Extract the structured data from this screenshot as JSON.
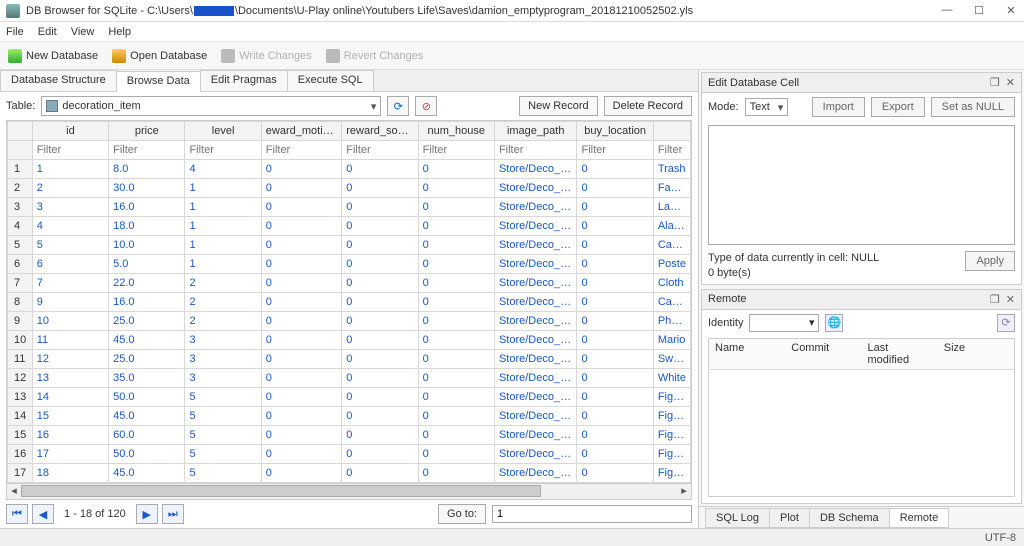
{
  "window": {
    "app": "DB Browser for SQLite",
    "path_prefix": "C:\\Users\\",
    "path_suffix": "\\Documents\\U-Play online\\Youtubers Life\\Saves\\damion_emptyprogram_20181210052502.yls",
    "min": "—",
    "max": "☐",
    "close": "✕"
  },
  "menu": [
    "File",
    "Edit",
    "View",
    "Help"
  ],
  "toolbar": {
    "new": "New Database",
    "open": "Open Database",
    "write": "Write Changes",
    "revert": "Revert Changes"
  },
  "tabs": [
    "Database Structure",
    "Browse Data",
    "Edit Pragmas",
    "Execute SQL"
  ],
  "active_tab": 1,
  "table_label": "Table:",
  "table_name": "decoration_item",
  "new_record": "New Record",
  "delete_record": "Delete Record",
  "columns": [
    "id",
    "price",
    "level",
    "eward_motivatio",
    "reward_social",
    "num_house",
    "image_path",
    "buy_location"
  ],
  "last_col_placeholder": "Filter",
  "filter_placeholder": "Filter",
  "rows": [
    {
      "n": 1,
      "id": "1",
      "price": "8.0",
      "level": "4",
      "rm": "0",
      "rs": "0",
      "num": "0",
      "img": "Store/Deco_R...",
      "buy": "0",
      "last": "Trash"
    },
    {
      "n": 2,
      "id": "2",
      "price": "30.0",
      "level": "1",
      "rm": "0",
      "rs": "0",
      "num": "0",
      "img": "Store/Deco_R...",
      "buy": "0",
      "last": "Fan_c"
    },
    {
      "n": 3,
      "id": "3",
      "price": "16.0",
      "level": "1",
      "rm": "0",
      "rs": "0",
      "num": "0",
      "img": "Store/Deco_R...",
      "buy": "0",
      "last": "LavaL"
    },
    {
      "n": 4,
      "id": "4",
      "price": "18.0",
      "level": "1",
      "rm": "0",
      "rs": "0",
      "num": "0",
      "img": "Store/Deco_R...",
      "buy": "0",
      "last": "Alarm"
    },
    {
      "n": 5,
      "id": "5",
      "price": "10.0",
      "level": "1",
      "rm": "0",
      "rs": "0",
      "num": "0",
      "img": "Store/Deco_R...",
      "buy": "0",
      "last": "Carpe"
    },
    {
      "n": 6,
      "id": "6",
      "price": "5.0",
      "level": "1",
      "rm": "0",
      "rs": "0",
      "num": "0",
      "img": "Store/Deco_R...",
      "buy": "0",
      "last": "Poste"
    },
    {
      "n": 7,
      "id": "7",
      "price": "22.0",
      "level": "2",
      "rm": "0",
      "rs": "0",
      "num": "0",
      "img": "Store/Deco_R...",
      "buy": "0",
      "last": "Cloth"
    },
    {
      "n": 8,
      "id": "9",
      "price": "16.0",
      "level": "2",
      "rm": "0",
      "rs": "0",
      "num": "0",
      "img": "Store/Deco_R...",
      "buy": "0",
      "last": "Carpe"
    },
    {
      "n": 9,
      "id": "10",
      "price": "25.0",
      "level": "2",
      "rm": "0",
      "rs": "0",
      "num": "0",
      "img": "Store/Deco_R...",
      "buy": "0",
      "last": "Photo"
    },
    {
      "n": 10,
      "id": "11",
      "price": "45.0",
      "level": "3",
      "rm": "0",
      "rs": "0",
      "num": "0",
      "img": "Store/Deco_R...",
      "buy": "0",
      "last": "Mario"
    },
    {
      "n": 11,
      "id": "12",
      "price": "25.0",
      "level": "3",
      "rm": "0",
      "rs": "0",
      "num": "0",
      "img": "Store/Deco_R...",
      "buy": "0",
      "last": "Swipe"
    },
    {
      "n": 12,
      "id": "13",
      "price": "35.0",
      "level": "3",
      "rm": "0",
      "rs": "0",
      "num": "0",
      "img": "Store/Deco_R...",
      "buy": "0",
      "last": "White"
    },
    {
      "n": 13,
      "id": "14",
      "price": "50.0",
      "level": "5",
      "rm": "0",
      "rs": "0",
      "num": "0",
      "img": "Store/Deco_R...",
      "buy": "0",
      "last": "Figure"
    },
    {
      "n": 14,
      "id": "15",
      "price": "45.0",
      "level": "5",
      "rm": "0",
      "rs": "0",
      "num": "0",
      "img": "Store/Deco_R...",
      "buy": "0",
      "last": "Figure"
    },
    {
      "n": 15,
      "id": "16",
      "price": "60.0",
      "level": "5",
      "rm": "0",
      "rs": "0",
      "num": "0",
      "img": "Store/Deco_R...",
      "buy": "0",
      "last": "Figure"
    },
    {
      "n": 16,
      "id": "17",
      "price": "50.0",
      "level": "5",
      "rm": "0",
      "rs": "0",
      "num": "0",
      "img": "Store/Deco_R...",
      "buy": "0",
      "last": "Figure"
    },
    {
      "n": 17,
      "id": "18",
      "price": "45.0",
      "level": "5",
      "rm": "0",
      "rs": "0",
      "num": "0",
      "img": "Store/Deco_R...",
      "buy": "0",
      "last": "Figure"
    }
  ],
  "pager": {
    "range": "1 - 18 of 120",
    "goto_label": "Go to:",
    "goto_value": "1"
  },
  "right": {
    "edit_title": "Edit Database Cell",
    "mode_label": "Mode:",
    "mode_value": "Text",
    "import": "Import",
    "export": "Export",
    "setnull": "Set as NULL",
    "cell_type": "Type of data currently in cell: NULL",
    "cell_size": "0 byte(s)",
    "apply": "Apply",
    "remote_title": "Remote",
    "identity_label": "Identity",
    "rcols": [
      "Name",
      "Commit",
      "Last modified",
      "Size"
    ]
  },
  "bottom_tabs": [
    "SQL Log",
    "Plot",
    "DB Schema",
    "Remote"
  ],
  "bottom_active": 3,
  "status": "UTF-8"
}
